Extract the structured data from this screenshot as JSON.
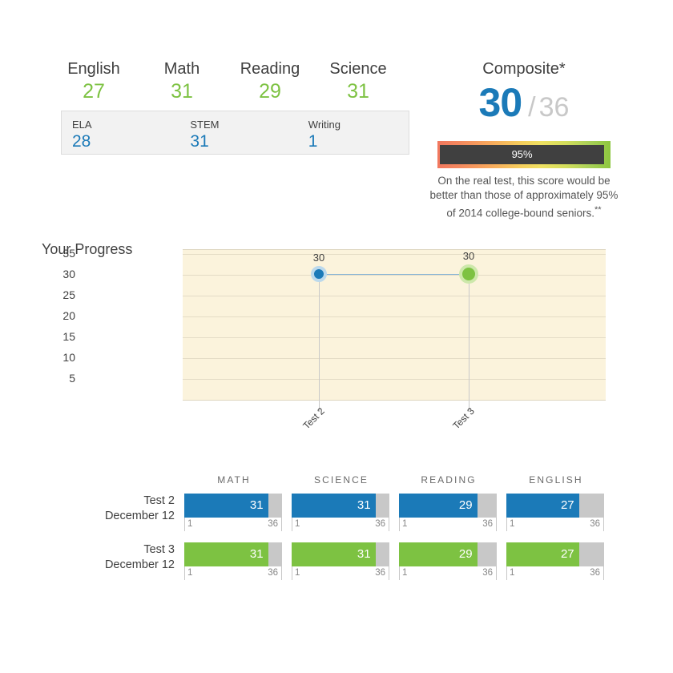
{
  "subject_scores": {
    "items": [
      {
        "name": "English",
        "value": "27"
      },
      {
        "name": "Math",
        "value": "31"
      },
      {
        "name": "Reading",
        "value": "29"
      },
      {
        "name": "Science",
        "value": "31"
      }
    ],
    "accent_color": "#7DC242"
  },
  "subscores": {
    "items": [
      {
        "label": "ELA",
        "value": "28"
      },
      {
        "label": "STEM",
        "value": "31"
      },
      {
        "label": "Writing",
        "value": "1"
      }
    ],
    "accent_color": "#1B7AB8"
  },
  "composite": {
    "title": "Composite*",
    "score": "30",
    "separator": "/",
    "max": "36",
    "percentile_label": "95%",
    "percentile_value": 95,
    "note": "On the real test, this score would be better than those of approximately 95% of 2014 college-bound seniors.",
    "note_superscript": "**",
    "score_color": "#1B7AB8",
    "max_color": "#c8c8c8",
    "gradient_start": "#F2785F",
    "gradient_end": "#8DC63F",
    "fill_color": "#404040"
  },
  "progress": {
    "title": "Your Progress",
    "chart_data": {
      "type": "line",
      "title": "Your Progress",
      "xlabel": "",
      "ylabel": "",
      "categories": [
        "Test 2",
        "Test 3"
      ],
      "x": [
        "Test 2",
        "Test 3"
      ],
      "values": [
        30,
        30
      ],
      "point_labels": [
        "30",
        "30"
      ],
      "point_colors": [
        "#1B7AB8",
        "#7DC242"
      ],
      "ylim": [
        0,
        36
      ],
      "yticks": [
        35,
        30,
        25,
        20,
        15,
        10,
        5
      ],
      "ytick_labels": [
        "35",
        "30",
        "25",
        "20",
        "15",
        "10",
        "5"
      ],
      "grid": true,
      "legend": "none",
      "plot_background": "#FBF3DC",
      "line_color": "#8ab6d6"
    }
  },
  "score_bars": {
    "columns": [
      "MATH",
      "SCIENCE",
      "READING",
      "ENGLISH"
    ],
    "scale_min": "1",
    "scale_max": "36",
    "scale_min_value": 1,
    "scale_max_value": 36,
    "rows": [
      {
        "name": "Test 2",
        "date": "December 12",
        "color": "#1B7AB8",
        "color_class": "blue",
        "values": [
          "31",
          "31",
          "29",
          "27"
        ],
        "numeric_values": [
          31,
          31,
          29,
          27
        ]
      },
      {
        "name": "Test 3",
        "date": "December 12",
        "color": "#7DC242",
        "color_class": "green",
        "values": [
          "31",
          "31",
          "29",
          "27"
        ],
        "numeric_values": [
          31,
          31,
          29,
          27
        ]
      }
    ]
  }
}
